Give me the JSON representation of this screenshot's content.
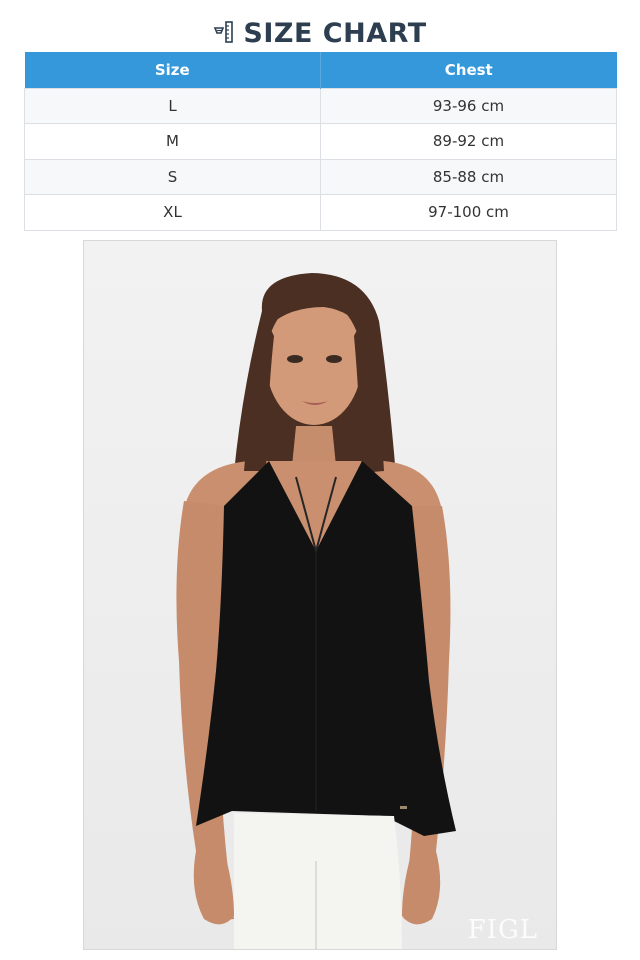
{
  "header": {
    "title": "SIZE CHART",
    "icon": "ruler-icon"
  },
  "size_table": {
    "columns": [
      "Size",
      "Chest"
    ],
    "rows": [
      {
        "size": "L",
        "chest": "93-96 cm"
      },
      {
        "size": "M",
        "chest": "89-92 cm"
      },
      {
        "size": "S",
        "chest": "85-88 cm"
      },
      {
        "size": "XL",
        "chest": "97-100 cm"
      }
    ]
  },
  "product_photo": {
    "watermark": "FIGL"
  },
  "colors": {
    "header_bg": "#3498db",
    "title_text": "#2c3e50",
    "row_alt": "#f6f8fa"
  }
}
